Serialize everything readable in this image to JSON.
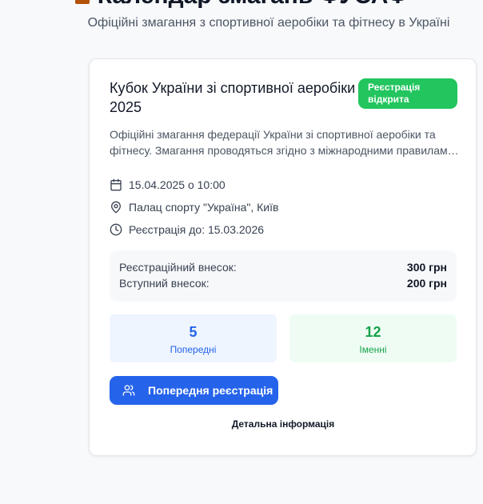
{
  "header": {
    "title": "Календар змагань ФУСАФ",
    "subtitle": "Офіційні змагання з спортивної аеробіки та фітнесу в Україні"
  },
  "event": {
    "title": "Кубок України зі спортивної аеробіки 2025",
    "status_badge": "Реєстрація відкрита",
    "description_line1": "Офіційні змагання федерації України зі спортивної аеробіки та",
    "description_line2": "фітнесу. Змагання проводяться згідно з міжнародними правилами...",
    "date": "15.04.2025 о 10:00",
    "location": "Палац спорту \"Україна\", Київ",
    "registration_deadline": "Реєстрація до: 15.03.2026",
    "fees": {
      "registration_label": "Реєстраційний внесок:",
      "registration_value": "300 грн",
      "entry_label": "Вступний внесок:",
      "entry_value": "200 грн"
    },
    "stats": {
      "preliminary_count": "5",
      "preliminary_label": "Попередні",
      "named_count": "12",
      "named_label": "Іменні"
    },
    "register_button": "Попередня реєстрація",
    "details_link": "Детальна інформація"
  },
  "icons": [
    "trophy-icon",
    "calendar-icon",
    "map-pin-icon",
    "clock-icon",
    "users-icon"
  ],
  "colors": {
    "primary": "#2563eb",
    "success": "#22c55e",
    "stat_blue_bg": "#eef5ff",
    "stat_green_bg": "#effcf4"
  }
}
